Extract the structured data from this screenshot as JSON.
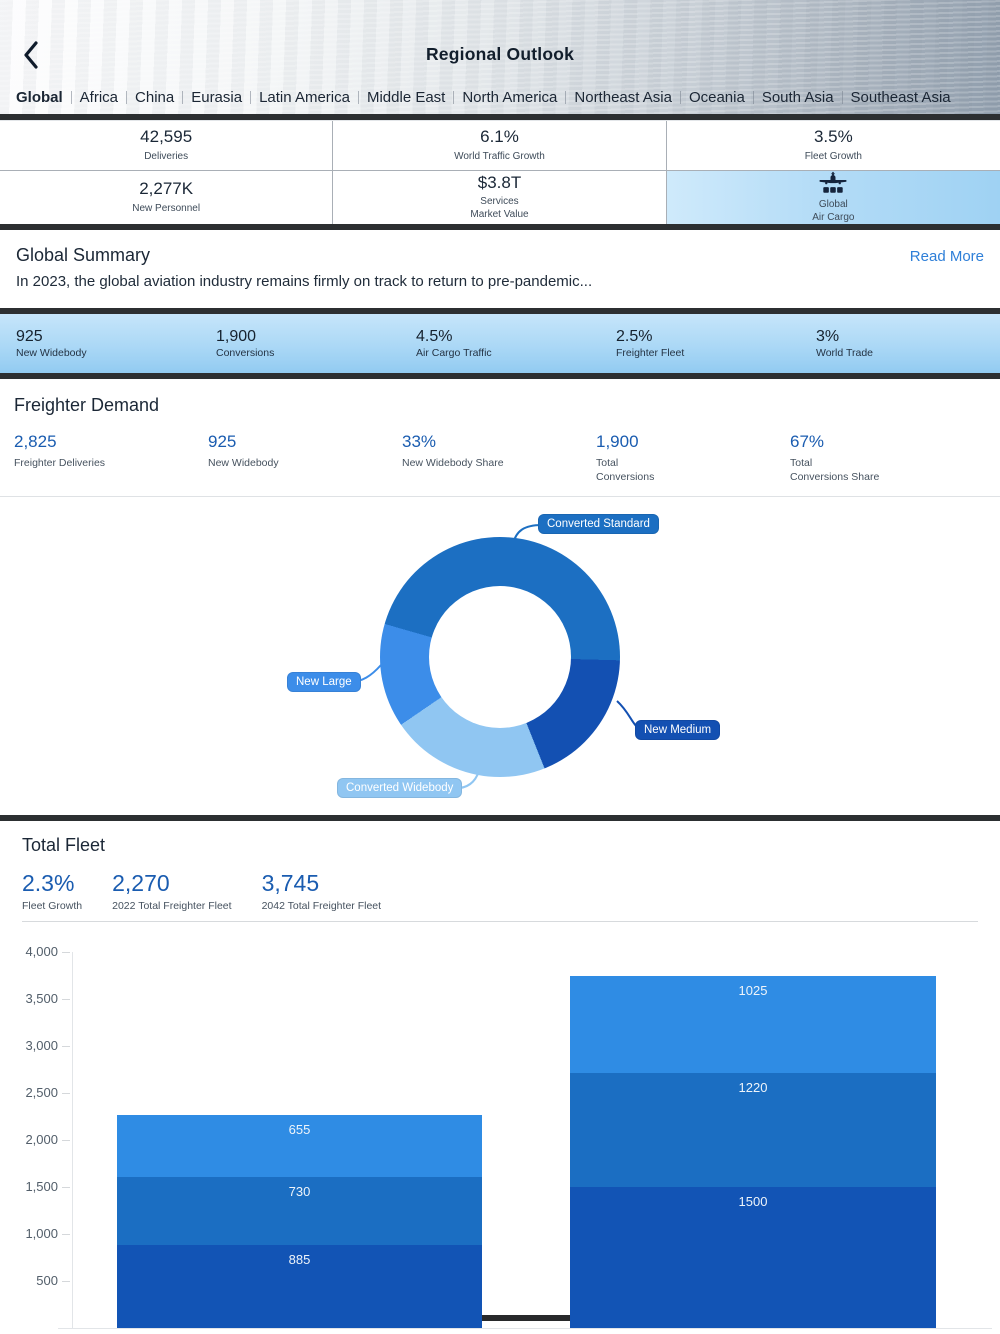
{
  "header": {
    "title": "Regional Outlook",
    "back_icon": "chevron-left-icon"
  },
  "tabs": [
    {
      "label": "Global",
      "selected": true
    },
    {
      "label": "Africa",
      "selected": false
    },
    {
      "label": "China",
      "selected": false
    },
    {
      "label": "Eurasia",
      "selected": false
    },
    {
      "label": "Latin America",
      "selected": false
    },
    {
      "label": "Middle East",
      "selected": false
    },
    {
      "label": "North America",
      "selected": false
    },
    {
      "label": "Northeast Asia",
      "selected": false
    },
    {
      "label": "Oceania",
      "selected": false
    },
    {
      "label": "South Asia",
      "selected": false
    },
    {
      "label": "Southeast Asia",
      "selected": false
    }
  ],
  "stats_grid": {
    "cells": [
      {
        "value": "42,595",
        "label": "Deliveries"
      },
      {
        "value": "6.1%",
        "label": "World Traffic Growth"
      },
      {
        "value": "3.5%",
        "label": "Fleet Growth"
      },
      {
        "value": "2,277K",
        "label": "New Personnel"
      },
      {
        "value": "$3.8T",
        "label": "Services\nMarket Value"
      },
      {
        "icon": "cargo-airplane-icon",
        "label": "Global\nAir Cargo",
        "highlighted": true
      }
    ]
  },
  "summary": {
    "title": "Global Summary",
    "read_more": "Read More",
    "text": "In 2023, the global aviation industry remains firmly on track to return to pre-pandemic..."
  },
  "highlight_bar": {
    "stats": [
      {
        "value": "925",
        "label": "New Widebody"
      },
      {
        "value": "1,900",
        "label": "Conversions"
      },
      {
        "value": "4.5%",
        "label": "Air Cargo Traffic"
      },
      {
        "value": "2.5%",
        "label": "Freighter Fleet"
      },
      {
        "value": "3%",
        "label": "World Trade"
      }
    ]
  },
  "freighter_demand": {
    "title": "Freighter Demand",
    "stats": [
      {
        "value": "2,825",
        "label": "Freighter Deliveries"
      },
      {
        "value": "925",
        "label": "New Widebody"
      },
      {
        "value": "33%",
        "label": "New Widebody Share"
      },
      {
        "value": "1,900",
        "label": "Total\nConversions"
      },
      {
        "value": "67%",
        "label": "Total\nConversions Share"
      }
    ]
  },
  "total_fleet": {
    "title": "Total Fleet",
    "stats": [
      {
        "value": "2.3%",
        "label": "Fleet Growth"
      },
      {
        "value": "2,270",
        "label": "2022 Total Freighter Fleet"
      },
      {
        "value": "3,745",
        "label": "2042 Total Freighter Fleet"
      }
    ]
  },
  "chart_data": [
    {
      "type": "pie",
      "subtype": "donut",
      "title": "Freighter demand mix",
      "start_angle_deg": -74,
      "legend_position": "callout-pills",
      "segments": [
        {
          "label": "Converted Standard",
          "share_pct": 46.0,
          "color": "#1c6fc2"
        },
        {
          "label": "New Medium",
          "share_pct": 18.5,
          "color": "#1350b2"
        },
        {
          "label": "Converted Widebody",
          "share_pct": 21.5,
          "color": "#90c6f2"
        },
        {
          "label": "New Large",
          "share_pct": 14.0,
          "color": "#3c8de9"
        }
      ]
    },
    {
      "type": "bar",
      "subtype": "stacked",
      "title": "Total freighter fleet",
      "ylim": [
        0,
        4000
      ],
      "grid": false,
      "y_tick_labels": [
        "500",
        "1,000",
        "1,500",
        "2,000",
        "2,500",
        "3,000",
        "3,500",
        "4,000"
      ],
      "y_tick_values": [
        500,
        1000,
        1500,
        2000,
        2500,
        3000,
        3500,
        4000
      ],
      "bars": [
        {
          "total": 2270,
          "segments": [
            {
              "value": 885,
              "label": "885",
              "color": "#1254b5"
            },
            {
              "value": 730,
              "label": "730",
              "color": "#1b6ec2"
            },
            {
              "value": 655,
              "label": "655",
              "color": "#2f8ce4"
            }
          ]
        },
        {
          "total": 3745,
          "segments": [
            {
              "value": 1500,
              "label": "1500",
              "color": "#1254b5"
            },
            {
              "value": 1220,
              "label": "1220",
              "color": "#1b6ec2"
            },
            {
              "value": 1025,
              "label": "1025",
              "color": "#2f8ce4"
            }
          ]
        }
      ]
    }
  ],
  "colors": {
    "stat_value_blue": "#1a5cb0",
    "link_blue": "#2e7fd8",
    "dark_divider": "#2c2f31",
    "navy_text": "#16222f",
    "highlight_bar_top": "#c6e5fa",
    "highlight_bar_bottom": "#92cbf1"
  }
}
